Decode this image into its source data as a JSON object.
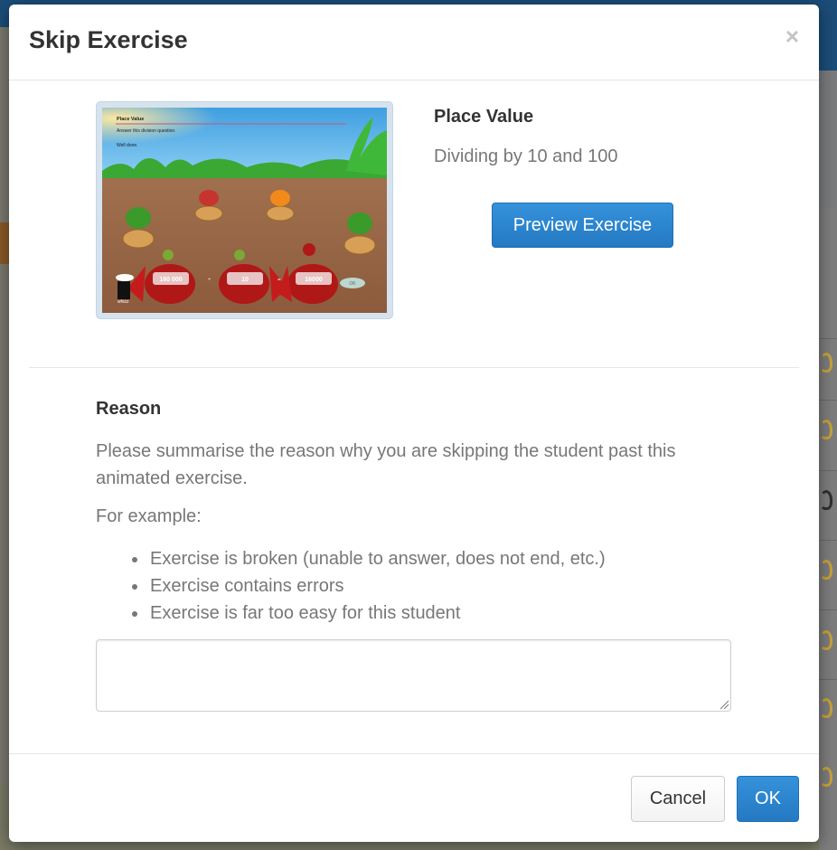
{
  "dialog": {
    "title": "Skip Exercise",
    "close_label": "×"
  },
  "exercise": {
    "name": "Place Value",
    "subtitle": "Dividing by 10 and 100",
    "preview_button": "Preview Exercise",
    "thumbnail": {
      "heading": "Place Value",
      "instruction": "Answer this division question.",
      "feedback": "Well done.",
      "values": [
        "160 000",
        "10",
        "16000"
      ],
      "operators": [
        "÷",
        "="
      ],
      "ok_label": "OK",
      "brand": "whizz"
    }
  },
  "reason": {
    "title": "Reason",
    "description": "Please summarise the reason why you are skipping the student past this animated exercise.",
    "example_intro": "For example:",
    "examples": [
      "Exercise is broken (unable to answer, does not end, etc.)",
      "Exercise contains errors",
      "Exercise is far too easy for this student"
    ],
    "input_value": ""
  },
  "footer": {
    "cancel_label": "Cancel",
    "ok_label": "OK"
  },
  "colors": {
    "primary": "#2a85ce",
    "overlay": "#7a7b7d"
  }
}
